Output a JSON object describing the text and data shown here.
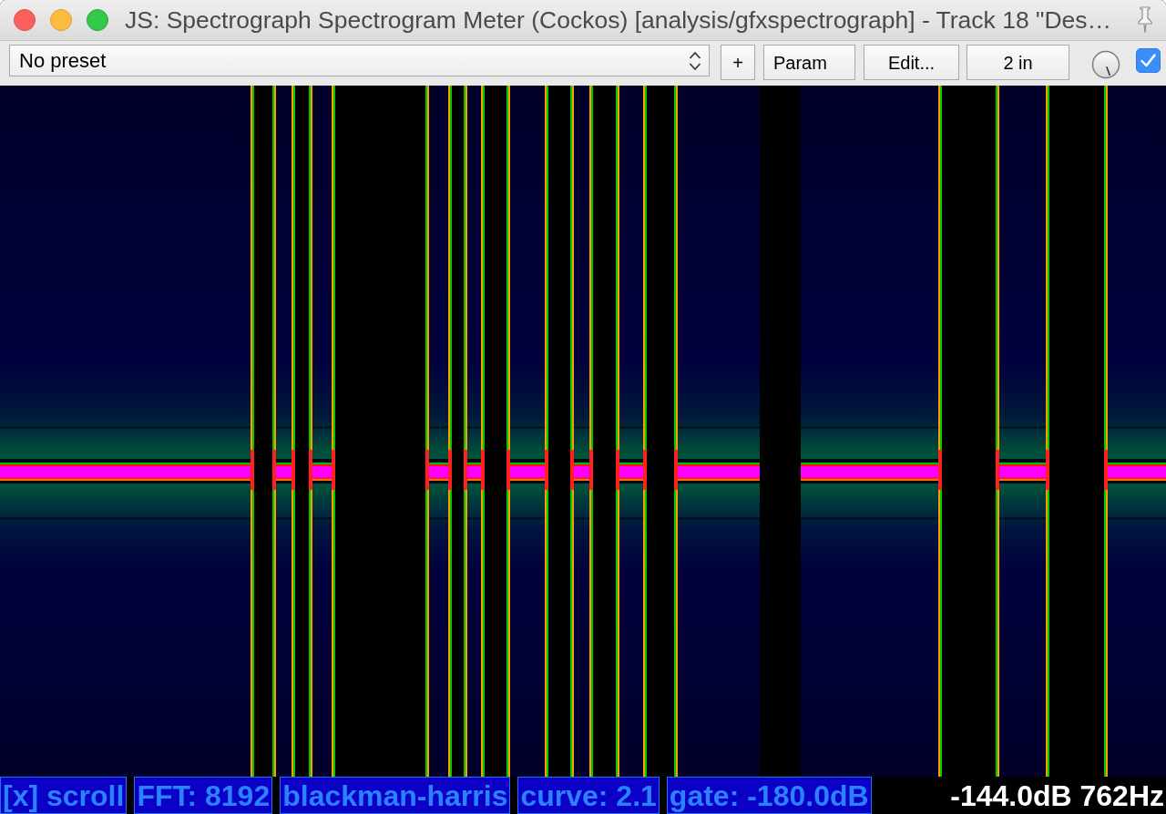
{
  "window": {
    "title": "JS: Spectrograph Spectrogram Meter (Cockos) [analysis/gfxspectrograph] - Track 18 \"Des…"
  },
  "toolbar": {
    "preset_dropdown": {
      "value": "No preset"
    },
    "buttons": [
      {
        "label": "+"
      },
      {
        "label": "Param"
      },
      {
        "label": "Edit..."
      },
      {
        "label": "2 in"
      }
    ],
    "knob": {
      "level": 1
    },
    "checkbox": {
      "checked": true
    }
  },
  "status_bar": {
    "chips": [
      {
        "label": "[x] scroll"
      },
      {
        "label": "FFT: 8192"
      },
      {
        "label": "blackman-harris"
      },
      {
        "label": "curve: 2.1"
      },
      {
        "label": "gate: -180.0dB"
      }
    ],
    "readout": "-144.0dB 762Hz"
  }
}
